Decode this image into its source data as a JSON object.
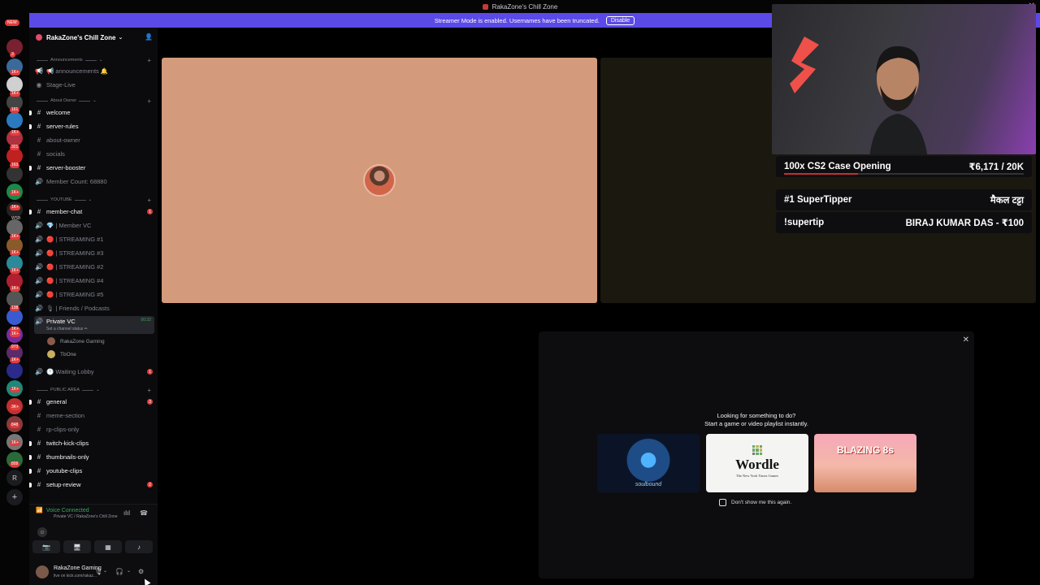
{
  "window": {
    "title": "RakaZone's Chill Zone"
  },
  "banner": {
    "text": "Streamer Mode is enabled. Usernames have been truncated.",
    "button": "Disable"
  },
  "rail": {
    "new_badge": "NEW",
    "badges": [
      "3",
      "1K+",
      "1K+",
      "161",
      "1K+",
      "321",
      "163",
      "1K+",
      "1K+",
      "WSB",
      "1K+",
      "1K+",
      "1K+",
      "1K+",
      "138",
      "1K+",
      "1K+",
      "973",
      "1K+",
      "1K+",
      "3K+",
      "848",
      "1K+",
      "809"
    ],
    "letter": "R",
    "add": "+"
  },
  "server": {
    "name": "RakaZone's Chill Zone"
  },
  "categories": {
    "announcements": "Announcements",
    "about_owner": "About Owner",
    "youtube": "YOUTUBE",
    "public": "PUBLIC AREA"
  },
  "channels": {
    "announcements": "📢 announcements 🔔",
    "stage": "Stage-Live",
    "welcome": "welcome",
    "server_rules": "server-rules",
    "about_owner": "about-owner",
    "socials": "socials",
    "server_booster": "server-booster",
    "member_count": "Member Count: 68880",
    "member_chat": "member-chat",
    "member_vc": "💎 | Member VC",
    "streaming1": "🔴 | STREAMING #1",
    "streaming3": "🔴 | STREAMING #3",
    "streaming2": "🔴 | STREAMING #2",
    "streaming4": "🔴 | STREAMING #4",
    "streaming5": "🔴 | STREAMING #5",
    "friends": "🎙 | Friends / Podcasts",
    "private_vc": "Private VC",
    "private_vc_status": "Set a channel status ✏",
    "private_vc_timer": "00:32",
    "vc_user1": "RakaZone Gaming",
    "vc_user2": "TbOne",
    "waiting": "🕐 Waiting Lobby",
    "general": "general",
    "meme": "meme-section",
    "rp": "rp-clips-only",
    "twitch": "twitch-kick-clips",
    "thumbs": "thumbnails-only",
    "yt": "youtube-clips",
    "setup": "setup-review"
  },
  "voice": {
    "status": "Voice Connected",
    "location": "Private VC / RakaZone's Chill Zone"
  },
  "user": {
    "name": "RakaZone Gaming",
    "status": "live on kick.com/rakaz..."
  },
  "overlay": {
    "case_label": "100x CS2 Case Opening",
    "case_value": "₹6,171 / 20K",
    "case_progress": 0.31,
    "tipper_label": "#1 SuperTipper",
    "tipper_name": "मैकल टट्टा",
    "supertip_label": "!supertip",
    "supertip_value": "BIRAJ KUMAR DAS - ₹100"
  },
  "activity": {
    "line1": "Looking for something to do?",
    "line2": "Start a game or video playlist instantly.",
    "games": [
      {
        "name": "soulbound"
      },
      {
        "name": "Wordle",
        "subtitle": "The New York Times Games"
      },
      {
        "name": "BLAZING 8s"
      }
    ],
    "dont_show": "Don't show me this again."
  },
  "colors": {
    "accent": "#5b4ae8",
    "voice_green": "#3ba55d",
    "badge_red": "#e23c3c",
    "tile_bg": "#d49a7c"
  }
}
